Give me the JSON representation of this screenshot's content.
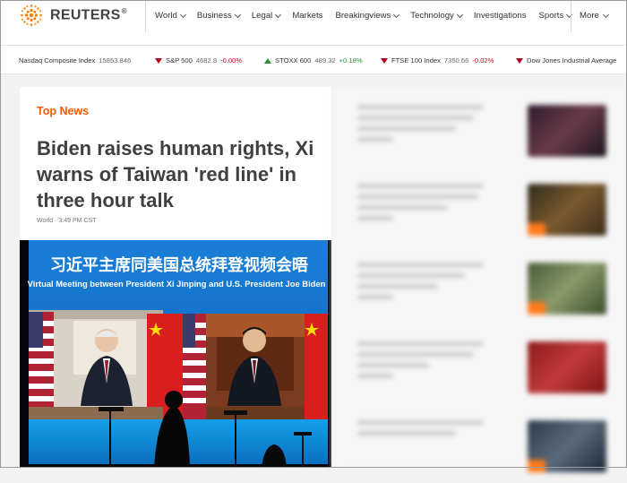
{
  "header": {
    "logo_text": "REUTERS",
    "logo_mark": "®",
    "nav": [
      {
        "label": "World",
        "dropdown": true
      },
      {
        "label": "Business",
        "dropdown": true
      },
      {
        "label": "Legal",
        "dropdown": true
      },
      {
        "label": "Markets",
        "dropdown": false
      },
      {
        "label": "Breakingviews",
        "dropdown": true
      },
      {
        "label": "Technology",
        "dropdown": true
      },
      {
        "label": "Investigations",
        "dropdown": false
      },
      {
        "label": "Sports",
        "dropdown": true
      }
    ],
    "more_label": "More",
    "brand_color": "#ff8000"
  },
  "ticker": [
    {
      "name": "Nasdaq Composite Index",
      "value": "15853.846",
      "change": "",
      "direction": "none"
    },
    {
      "name": "S&P 500",
      "value": "4682.8",
      "change": "-0.00%",
      "direction": "down"
    },
    {
      "name": "STOXX 600",
      "value": "489.32",
      "change": "+0.18%",
      "direction": "up"
    },
    {
      "name": "FTSE 100 Index",
      "value": "7350.66",
      "change": "-0.02%",
      "direction": "down"
    },
    {
      "name": "Dow Jones Industrial Average",
      "value": "",
      "change": "",
      "direction": "down"
    }
  ],
  "main": {
    "section_label": "Top News",
    "headline": "Biden raises human rights, Xi warns of Taiwan 'red line' in three hour talk",
    "meta": "World · 3:49 PM CST",
    "image": {
      "banner_cn": "习近平主席同美国总统拜登视频会晤",
      "banner_en": "Virtual Meeting between President Xi Jinping and U.S. President Joe Biden"
    }
  },
  "colors": {
    "accent": "#ff5a00",
    "down": "#d0021b",
    "up": "#2e8b3a"
  }
}
